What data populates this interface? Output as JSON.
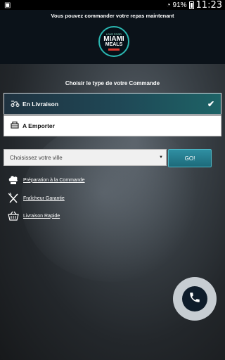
{
  "status_bar": {
    "battery": "91%",
    "time": "11:23"
  },
  "header": {
    "slogan": "Vous pouvez commander votre repas maintenant",
    "logo": {
      "top_text": "LOVE FOOD",
      "line1": "MIAMI",
      "line2": "MEALS",
      "accent": "#2bb7b1"
    }
  },
  "order_type": {
    "title": "Choisir le type de votre Commande",
    "options": [
      {
        "label": "En Livraison",
        "icon": "delivery-scooter-icon",
        "selected": true
      },
      {
        "label": "A Emporter",
        "icon": "takeaway-basket-icon",
        "selected": false
      }
    ]
  },
  "city_select": {
    "placeholder": "Choisissez votre ville",
    "go_label": "GO!"
  },
  "features": [
    {
      "label": "Préparation à la Commande",
      "icon": "chef-hat-icon"
    },
    {
      "label": "Fraîcheur Garantie",
      "icon": "fork-knife-icon"
    },
    {
      "label": "Livraison Rapide",
      "icon": "basket-icon"
    }
  ],
  "call_button": {
    "icon": "phone-icon"
  },
  "colors": {
    "header_bg": "#0b1219",
    "selected_gradient_start": "#1f3240",
    "selected_gradient_end": "#1d6366",
    "go_button": "#2f8fa2"
  }
}
